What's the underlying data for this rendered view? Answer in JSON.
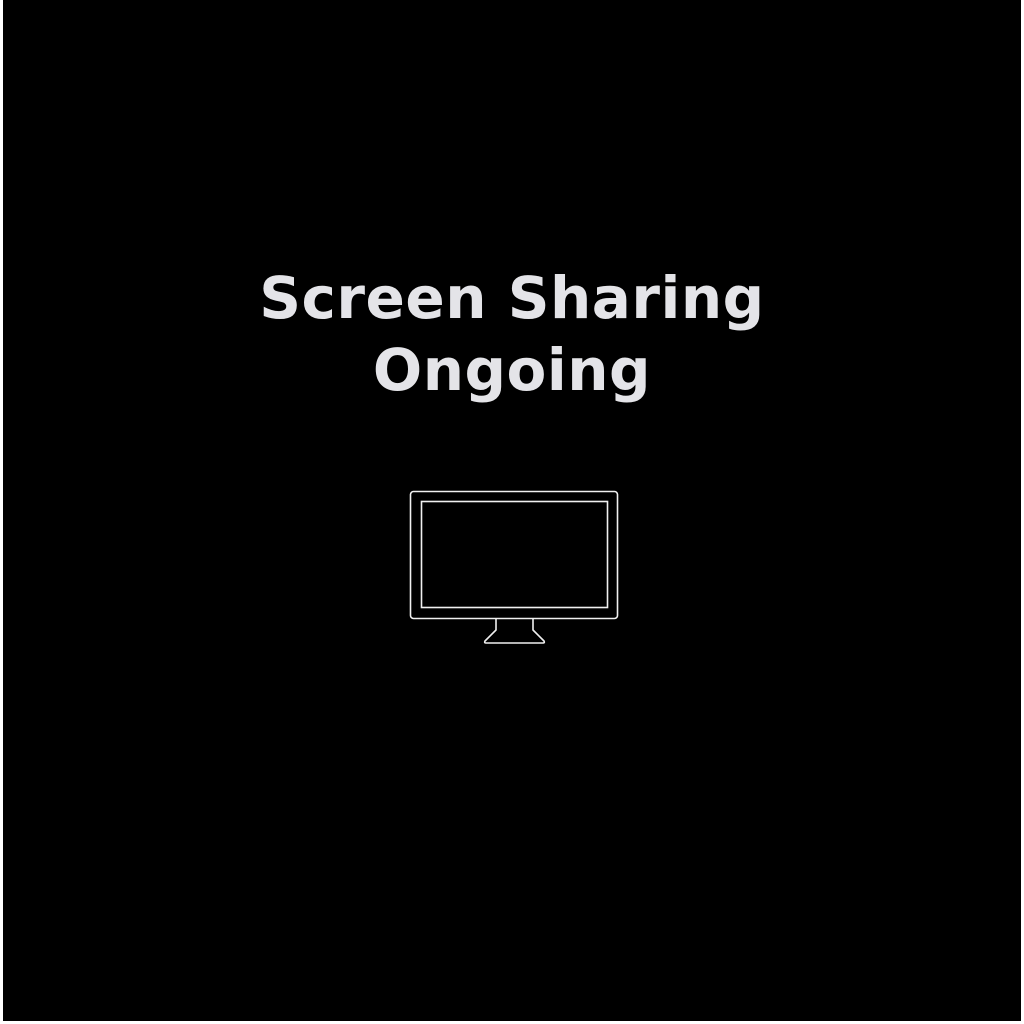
{
  "screen_share": {
    "title_line_1": "Screen Sharing",
    "title_line_2": "Ongoing",
    "icon": "monitor-icon"
  },
  "colors": {
    "background": "#000000",
    "text": "#e4e4e8",
    "icon_stroke": "#f0f0f0",
    "page_border": "#ffffff"
  }
}
